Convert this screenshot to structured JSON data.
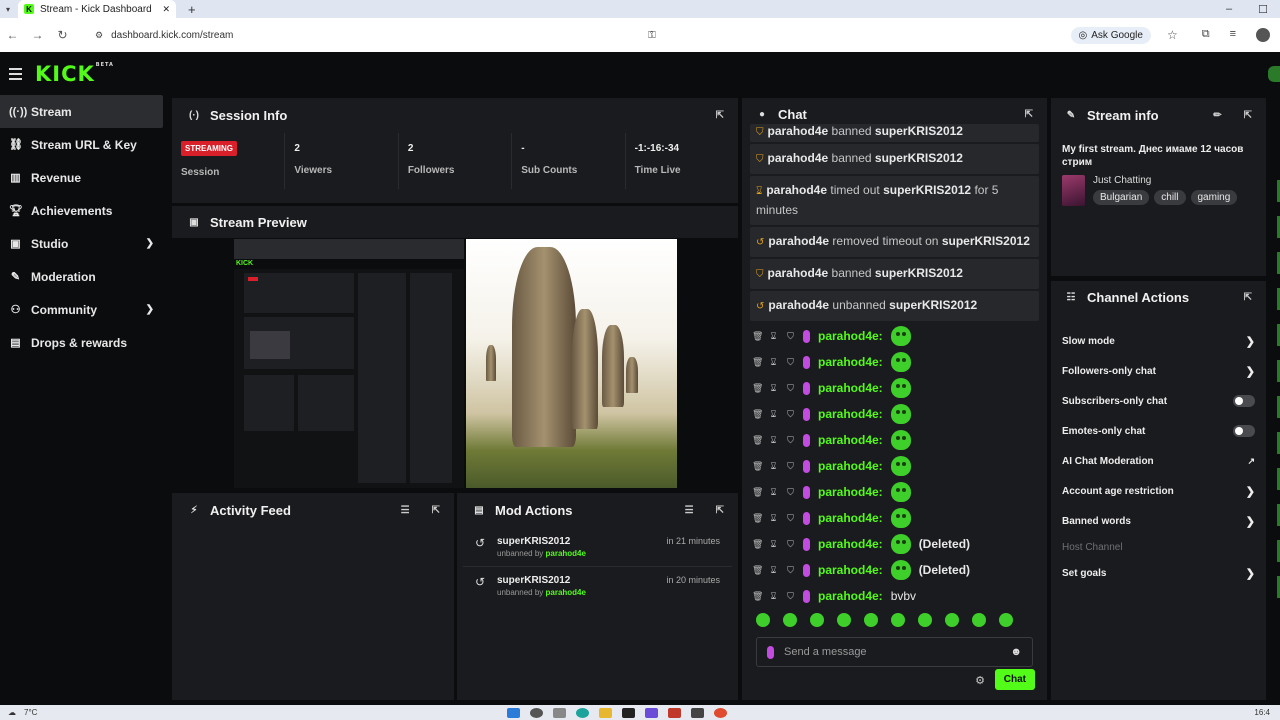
{
  "browser": {
    "tab_title": "Stream - Kick Dashboard",
    "new_tab": "+",
    "url": "dashboard.kick.com/stream",
    "ask_google": "Ask Google"
  },
  "app": {
    "logo": "KICK",
    "logo_sup": "BETA"
  },
  "sidebar": {
    "items": [
      {
        "label": "Stream",
        "icon": "radio-icon"
      },
      {
        "label": "Stream URL & Key",
        "icon": "link-icon"
      },
      {
        "label": "Revenue",
        "icon": "chart-icon"
      },
      {
        "label": "Achievements",
        "icon": "trophy-icon"
      },
      {
        "label": "Studio",
        "icon": "studio-icon"
      },
      {
        "label": "Moderation",
        "icon": "wrench-icon"
      },
      {
        "label": "Community",
        "icon": "people-icon"
      },
      {
        "label": "Drops & rewards",
        "icon": "gift-icon"
      }
    ]
  },
  "session": {
    "title": "Session Info",
    "status_badge": "STREAMING",
    "stats": [
      {
        "value": "",
        "label": "Session"
      },
      {
        "value": "2",
        "label": "Viewers"
      },
      {
        "value": "2",
        "label": "Followers"
      },
      {
        "value": "-",
        "label": "Sub Counts"
      },
      {
        "value": "-1:-16:-34",
        "label": "Time Live"
      }
    ]
  },
  "preview": {
    "title": "Stream Preview"
  },
  "activity": {
    "title": "Activity Feed"
  },
  "mod_actions": {
    "title": "Mod Actions",
    "items": [
      {
        "user": "superKRIS2012",
        "action": "unbanned by",
        "by": "parahod4e",
        "time": "in 21 minutes"
      },
      {
        "user": "superKRIS2012",
        "action": "unbanned by",
        "by": "parahod4e",
        "time": "in 20 minutes"
      }
    ]
  },
  "chat": {
    "title": "Chat",
    "system_messages": [
      {
        "actor": "parahod4e",
        "text": "banned",
        "target": "superKRIS2012",
        "tail": ""
      },
      {
        "actor": "parahod4e",
        "text": "banned",
        "target": "superKRIS2012",
        "tail": ""
      },
      {
        "actor": "parahod4e",
        "text": "timed out",
        "target": "superKRIS2012",
        "tail": "for 5 minutes"
      },
      {
        "actor": "parahod4e",
        "text": "removed timeout on",
        "target": "superKRIS2012",
        "tail": ""
      },
      {
        "actor": "parahod4e",
        "text": "banned",
        "target": "superKRIS2012",
        "tail": ""
      },
      {
        "actor": "parahod4e",
        "text": "unbanned",
        "target": "superKRIS2012",
        "tail": ""
      }
    ],
    "messages": [
      {
        "user": "parahod4e:",
        "text": ""
      },
      {
        "user": "parahod4e:",
        "text": ""
      },
      {
        "user": "parahod4e:",
        "text": ""
      },
      {
        "user": "parahod4e:",
        "text": ""
      },
      {
        "user": "parahod4e:",
        "text": ""
      },
      {
        "user": "parahod4e:",
        "text": ""
      },
      {
        "user": "parahod4e:",
        "text": ""
      },
      {
        "user": "parahod4e:",
        "text": ""
      },
      {
        "user": "parahod4e:",
        "text": "(Deleted)"
      },
      {
        "user": "parahod4e:",
        "text": "(Deleted)"
      },
      {
        "user": "parahod4e:",
        "text": "bvbv"
      }
    ],
    "placeholder": "Send a message",
    "send_label": "Chat"
  },
  "stream_info": {
    "title": "Stream info",
    "stream_title": "My first stream. Днес имаме 12 часов стрим",
    "category": "Just Chatting",
    "tags": [
      "Bulgarian",
      "chill",
      "gaming"
    ]
  },
  "channel_actions": {
    "title": "Channel Actions",
    "items": [
      {
        "label": "Slow mode",
        "control": "chevron"
      },
      {
        "label": "Followers-only chat",
        "control": "chevron"
      },
      {
        "label": "Subscribers-only chat",
        "control": "toggle"
      },
      {
        "label": "Emotes-only chat",
        "control": "toggle"
      },
      {
        "label": "AI Chat Moderation",
        "control": "external"
      },
      {
        "label": "Account age restriction",
        "control": "chevron"
      },
      {
        "label": "Banned words",
        "control": "chevron"
      }
    ],
    "section": "Host Channel",
    "set_goals": "Set goals"
  },
  "taskbar": {
    "weather": "7°C",
    "time": "16:4"
  },
  "colors": {
    "brand": "#53fc18",
    "live": "#d9202a",
    "panel": "#1a1b1e"
  }
}
